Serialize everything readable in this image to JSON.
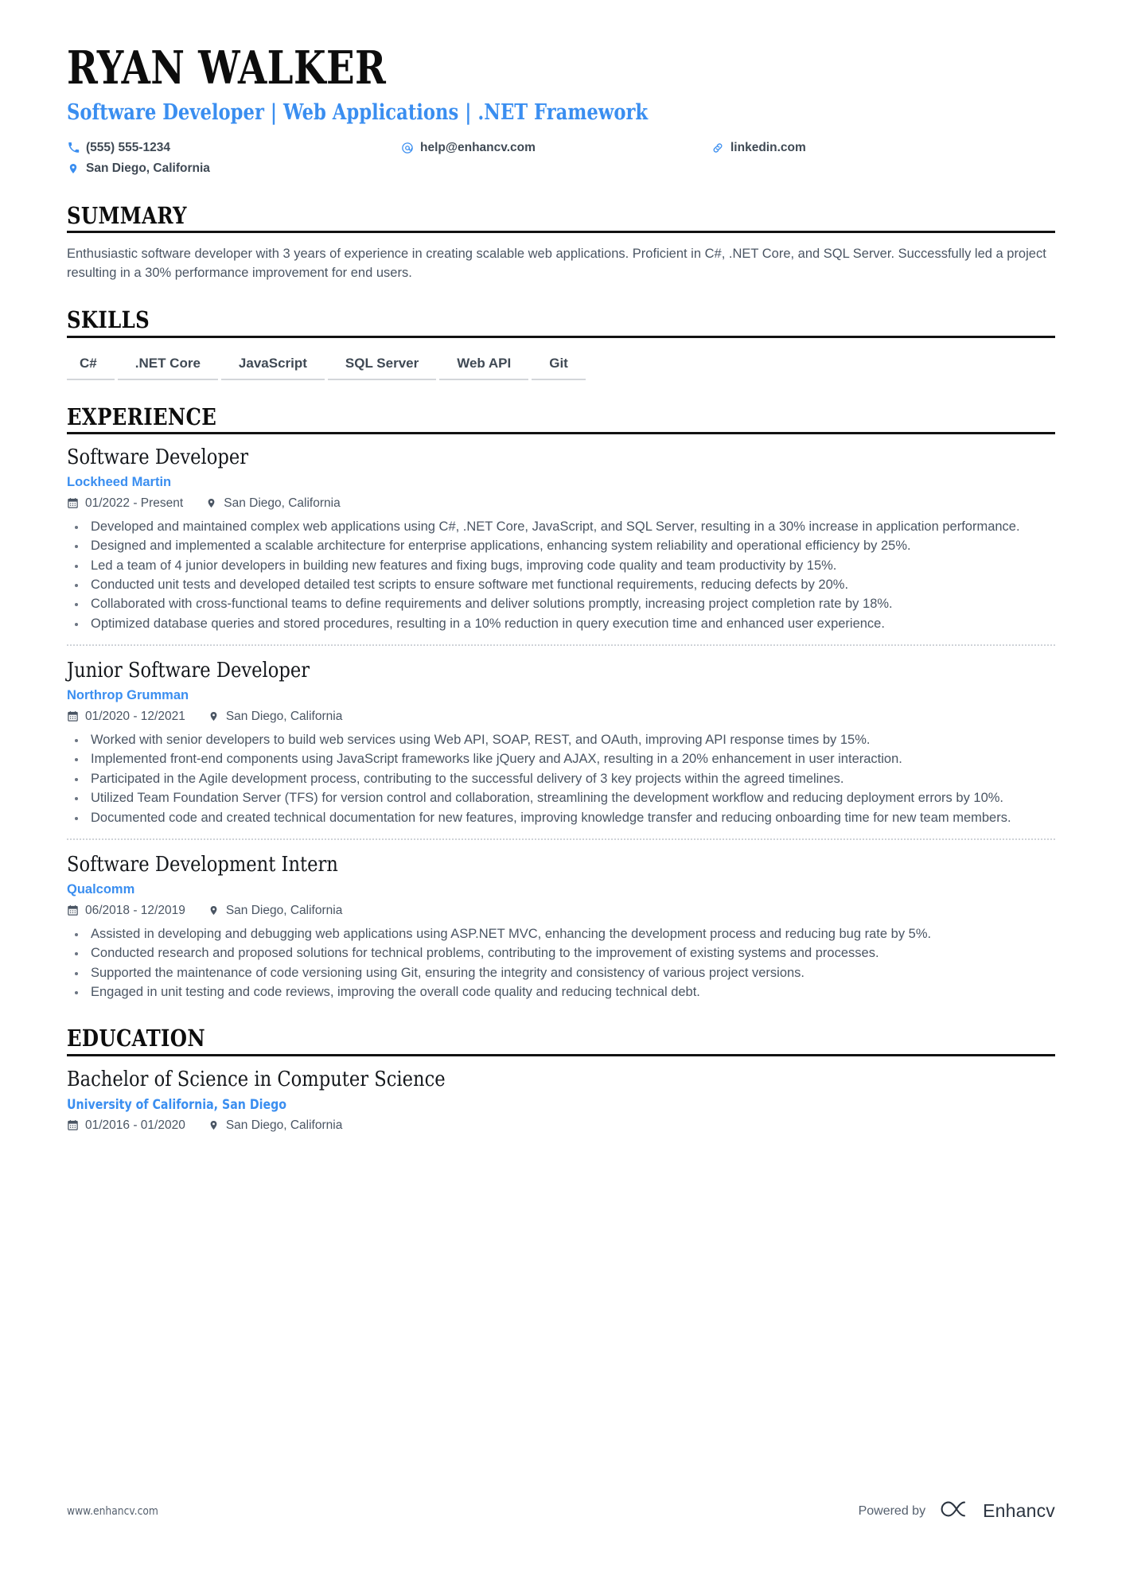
{
  "theme": {
    "accent": "#3a8ef0",
    "heading": "#0d0d0d",
    "body_text": "#4a5563",
    "rule": "#121212",
    "skill_underline": "#d3d6da"
  },
  "header": {
    "name": "RYAN WALKER",
    "headline": "Software Developer | Web Applications | .NET Framework",
    "contacts": [
      {
        "icon": "phone-icon",
        "value": "(555) 555-1234"
      },
      {
        "icon": "email-icon",
        "value": "help@enhancv.com"
      },
      {
        "icon": "link-icon",
        "value": "linkedin.com"
      },
      {
        "icon": "location-icon",
        "value": "San Diego, California"
      }
    ]
  },
  "sections": {
    "summary": {
      "title": "SUMMARY",
      "text": "Enthusiastic software developer with 3 years of experience in creating scalable web applications. Proficient in C#, .NET Core, and SQL Server. Successfully led a project resulting in a 30% performance improvement for end users."
    },
    "skills": {
      "title": "SKILLS",
      "items": [
        "C#",
        ".NET Core",
        "JavaScript",
        "SQL Server",
        "Web API",
        "Git"
      ]
    },
    "experience": {
      "title": "EXPERIENCE",
      "entries": [
        {
          "title": "Software Developer",
          "organization": "Lockheed Martin",
          "dates": "01/2022 - Present",
          "location": "San Diego, California",
          "bullets": [
            "Developed and maintained complex web applications using C#, .NET Core, JavaScript, and SQL Server, resulting in a 30% increase in application performance.",
            "Designed and implemented a scalable architecture for enterprise applications, enhancing system reliability and operational efficiency by 25%.",
            "Led a team of 4 junior developers in building new features and fixing bugs, improving code quality and team productivity by 15%.",
            "Conducted unit tests and developed detailed test scripts to ensure software met functional requirements, reducing defects by 20%.",
            "Collaborated with cross-functional teams to define requirements and deliver solutions promptly, increasing project completion rate by 18%.",
            "Optimized database queries and stored procedures, resulting in a 10% reduction in query execution time and enhanced user experience."
          ]
        },
        {
          "title": "Junior Software Developer",
          "organization": "Northrop Grumman",
          "dates": "01/2020 - 12/2021",
          "location": "San Diego, California",
          "bullets": [
            "Worked with senior developers to build web services using Web API, SOAP, REST, and OAuth, improving API response times by 15%.",
            "Implemented front-end components using JavaScript frameworks like jQuery and AJAX, resulting in a 20% enhancement in user interaction.",
            "Participated in the Agile development process, contributing to the successful delivery of 3 key projects within the agreed timelines.",
            "Utilized Team Foundation Server (TFS) for version control and collaboration, streamlining the development workflow and reducing deployment errors by 10%.",
            "Documented code and created technical documentation for new features, improving knowledge transfer and reducing onboarding time for new team members."
          ]
        },
        {
          "title": "Software Development Intern",
          "organization": "Qualcomm",
          "dates": "06/2018 - 12/2019",
          "location": "San Diego, California",
          "bullets": [
            "Assisted in developing and debugging web applications using ASP.NET MVC, enhancing the development process and reducing bug rate by 5%.",
            "Conducted research and proposed solutions for technical problems, contributing to the improvement of existing systems and processes.",
            "Supported the maintenance of code versioning using Git, ensuring the integrity and consistency of various project versions.",
            "Engaged in unit testing and code reviews, improving the overall code quality and reducing technical debt."
          ]
        }
      ]
    },
    "education": {
      "title": "EDUCATION",
      "entries": [
        {
          "title": "Bachelor of Science in Computer Science",
          "organization": "University of California, San Diego",
          "dates": "01/2016 - 01/2020",
          "location": "San Diego, California"
        }
      ]
    }
  },
  "footer": {
    "url": "www.enhancv.com",
    "powered_by": "Powered by",
    "brand": "Enhancv"
  }
}
